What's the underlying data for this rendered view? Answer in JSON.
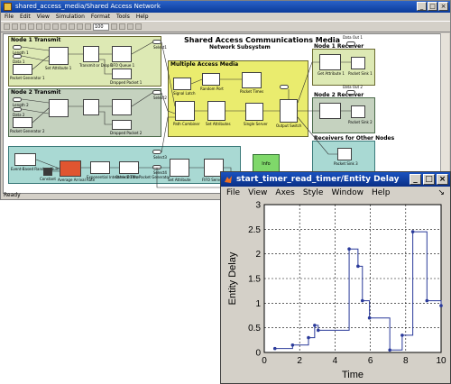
{
  "sim_window": {
    "title": "shared_access_media/Shared Access Network",
    "menu": [
      "File",
      "Edit",
      "View",
      "Simulation",
      "Format",
      "Tools",
      "Help"
    ],
    "stop_time": "100",
    "status": "Ready",
    "heading": "Shared Access Communications Media",
    "subheading": "Network Subsystem",
    "node1_tx": "Node 1 Transmit",
    "node2_tx": "Node 2 Transmit",
    "mam": "Multiple Access Media",
    "node1_rx": "Node 1 Receiver",
    "node2_rx": "Node 2 Receiver",
    "other_rx": "Receivers for Other Nodes",
    "info": "Info",
    "labels": {
      "length1": "Length 1",
      "data1": "Data 1",
      "pg1": "Packet Generator 1",
      "setattr1": "Set Attribute 1",
      "tx_drop1": "Transmit or Drop 1",
      "fifo1": "FIFO Queue 1",
      "dropped1": "Dropped Packet 1",
      "length2": "Length 2",
      "data2": "Data 2",
      "pg2": "Packet Generator 2",
      "dropped2": "Dropped Packet 2",
      "signal_latch": "Signal Latch",
      "random_port": "Random Port",
      "packet_times": "Packet Times",
      "path_combiner": "Path Combiner",
      "set_attrs": "Set Attributes",
      "single_server": "Single Server",
      "output_switch": "Output Switch",
      "get_attr1": "Get Attribute 1",
      "sink1": "Packet Sink 1",
      "sink2": "Packet Sink 2",
      "sink3": "Packet Sink 3",
      "data_out1": "Data Out 1",
      "data_out2": "Data Out 2",
      "event_based": "Event-Based Random Number",
      "constant": "Constant",
      "arrival_rate": "Average Arrival Rate",
      "exp_interarrival": "Exponential Interarrival Time",
      "other_traffic": "Other Traffic Packet Generator",
      "set_attr": "Set Attribute",
      "fifo_server": "FIFO Server",
      "selects": [
        "Select1",
        "Select2",
        "Select3",
        "Select4"
      ],
      "in_label": "IN",
      "out_label": "OUT"
    }
  },
  "plot_window": {
    "title": "start_timer_read_timer/Entity Delay",
    "menu": [
      "File",
      "View",
      "Axes",
      "Style",
      "Window",
      "Help"
    ],
    "corner_arrow": "↘"
  },
  "chart_data": {
    "type": "line",
    "title": "",
    "xlabel": "Time",
    "ylabel": "Entity Delay",
    "xlim": [
      0,
      10
    ],
    "ylim": [
      0,
      3
    ],
    "xticks": [
      0,
      2,
      4,
      6,
      8,
      10
    ],
    "yticks": [
      0,
      0.5,
      1,
      1.5,
      2,
      2.5,
      3
    ],
    "grid": "dotted",
    "line_color": "#2a3a9a",
    "series": [
      {
        "style": "stairs-with-markers",
        "x": [
          0.6,
          1.6,
          2.5,
          2.85,
          3.05,
          4.8,
          5.3,
          5.55,
          5.95,
          7.1,
          7.8,
          8.4,
          9.2,
          10.0
        ],
        "y": [
          0.08,
          0.15,
          0.3,
          0.55,
          0.45,
          2.1,
          1.75,
          1.05,
          0.7,
          0.05,
          0.35,
          2.45,
          1.05,
          0.95
        ]
      }
    ]
  }
}
